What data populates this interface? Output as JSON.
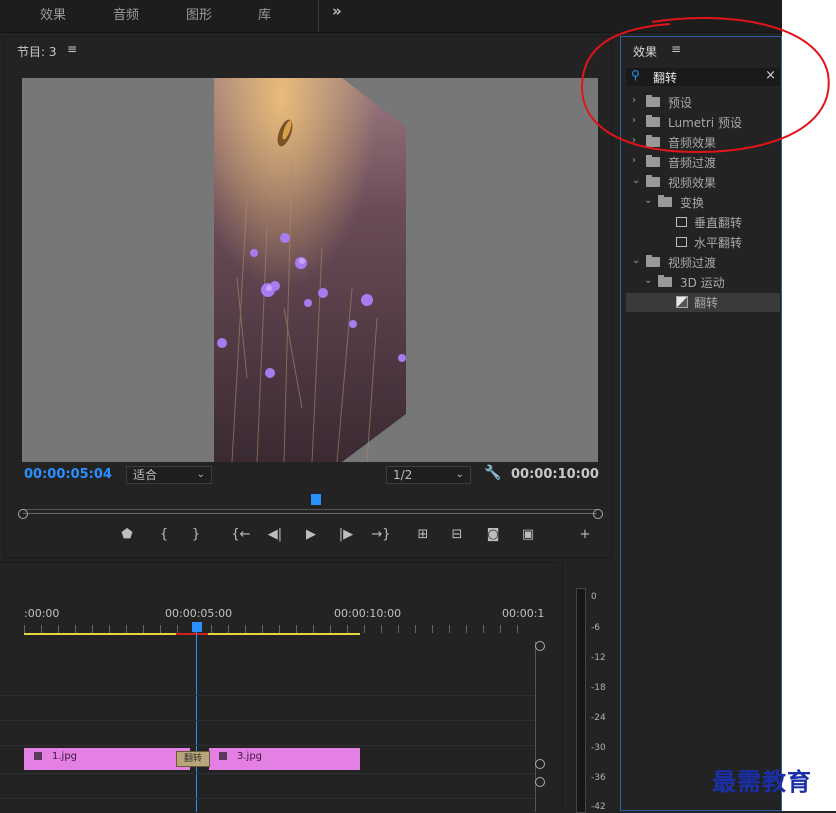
{
  "top_nav": {
    "items": [
      "效果",
      "音频",
      "图形",
      "库"
    ],
    "more": "»"
  },
  "program": {
    "title": "节目: 3",
    "menu": "≡",
    "timecode_current": "00:00:05:04",
    "fit_select": "适合",
    "resolution_select": "1/2",
    "timecode_duration": "00:00:10:00",
    "accent": "#2a8fff"
  },
  "effects_panel": {
    "title": "效果",
    "menu": "≡",
    "search_value": "翻转",
    "clear": "×",
    "tree": [
      {
        "label": "预设",
        "depth": 0,
        "expanded": false,
        "kind": "preset-folder"
      },
      {
        "label": "Lumetri 预设",
        "depth": 0,
        "expanded": false,
        "kind": "preset-folder"
      },
      {
        "label": "音频效果",
        "depth": 0,
        "expanded": false,
        "kind": "folder"
      },
      {
        "label": "音频过渡",
        "depth": 0,
        "expanded": false,
        "kind": "folder"
      },
      {
        "label": "视频效果",
        "depth": 0,
        "expanded": true,
        "kind": "folder"
      },
      {
        "label": "变换",
        "depth": 1,
        "expanded": true,
        "kind": "folder"
      },
      {
        "label": "垂直翻转",
        "depth": 2,
        "kind": "effect"
      },
      {
        "label": "水平翻转",
        "depth": 2,
        "kind": "effect"
      },
      {
        "label": "视频过渡",
        "depth": 0,
        "expanded": true,
        "kind": "folder"
      },
      {
        "label": "3D 运动",
        "depth": 1,
        "expanded": true,
        "kind": "folder"
      },
      {
        "label": "翻转",
        "depth": 2,
        "kind": "transition",
        "selected": true
      }
    ]
  },
  "timeline": {
    "ruler_labels": [
      ":00:00",
      "00:00:05:00",
      "00:00:10:00",
      "00:00:1"
    ],
    "clips": [
      {
        "name": "1.jpg"
      },
      {
        "name": "3.jpg"
      }
    ],
    "transition_label": "翻转",
    "playhead_color": "#2a8fff"
  },
  "meter": {
    "db_labels": [
      "0",
      "-6",
      "-12",
      "-18",
      "-24",
      "-30",
      "-36",
      "-42"
    ]
  },
  "watermark": "最需教育"
}
